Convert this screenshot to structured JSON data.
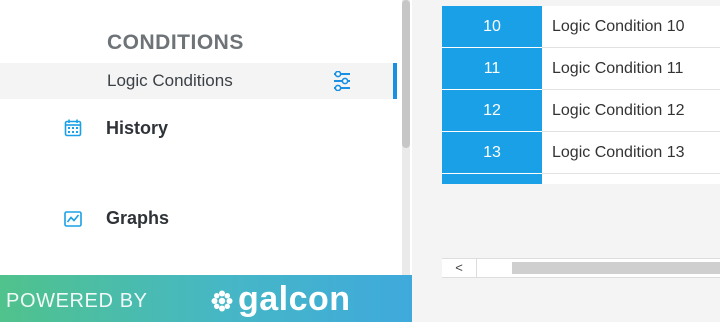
{
  "sidebar": {
    "section_heading": "CONDITIONS",
    "sub_item": {
      "label": "Logic Conditions",
      "icon": "sliders-icon"
    },
    "nav_items": [
      {
        "label": "History",
        "icon": "calendar-icon"
      },
      {
        "label": "Graphs",
        "icon": "line-chart-icon"
      }
    ],
    "footer": {
      "powered_by": "POWERED BY",
      "brand": "galcon"
    }
  },
  "table": {
    "rows": [
      {
        "number": "10",
        "name": "Logic Condition 10"
      },
      {
        "number": "11",
        "name": "Logic Condition 11"
      },
      {
        "number": "12",
        "name": "Logic Condition 12"
      },
      {
        "number": "13",
        "name": "Logic Condition 13"
      }
    ],
    "scroll_left_label": "<"
  },
  "colors": {
    "accent": "#1aa0e6",
    "active_indicator": "#1a8fe3",
    "footer_gradient_start": "#50c28c",
    "footer_gradient_end": "#3fa9dc"
  }
}
